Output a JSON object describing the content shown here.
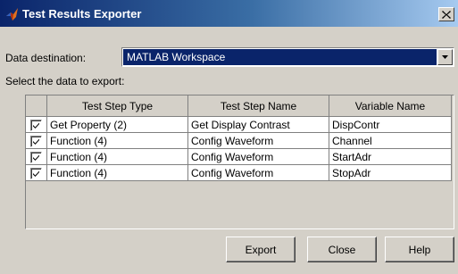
{
  "window": {
    "title": "Test Results Exporter",
    "icon": "matlab-logo-icon"
  },
  "destination": {
    "label": "Data destination:",
    "value": "MATLAB Workspace"
  },
  "select_label": "Select the data to export:",
  "table": {
    "headers": [
      "",
      "Test Step Type",
      "Test Step Name",
      "Variable Name"
    ],
    "rows": [
      {
        "checked": true,
        "type": "Get Property (2)",
        "name": "Get Display Contrast",
        "variable": "DispContr"
      },
      {
        "checked": true,
        "type": "Function (4)",
        "name": "Config Waveform",
        "variable": "Channel"
      },
      {
        "checked": true,
        "type": "Function (4)",
        "name": "Config Waveform",
        "variable": "StartAdr"
      },
      {
        "checked": true,
        "type": "Function (4)",
        "name": "Config Waveform",
        "variable": "StopAdr"
      }
    ]
  },
  "buttons": {
    "export": "Export",
    "close": "Close",
    "help": "Help"
  },
  "colors": {
    "title_bar": "#0a246a",
    "selection": "#0a246a",
    "face": "#d4d0c8"
  }
}
